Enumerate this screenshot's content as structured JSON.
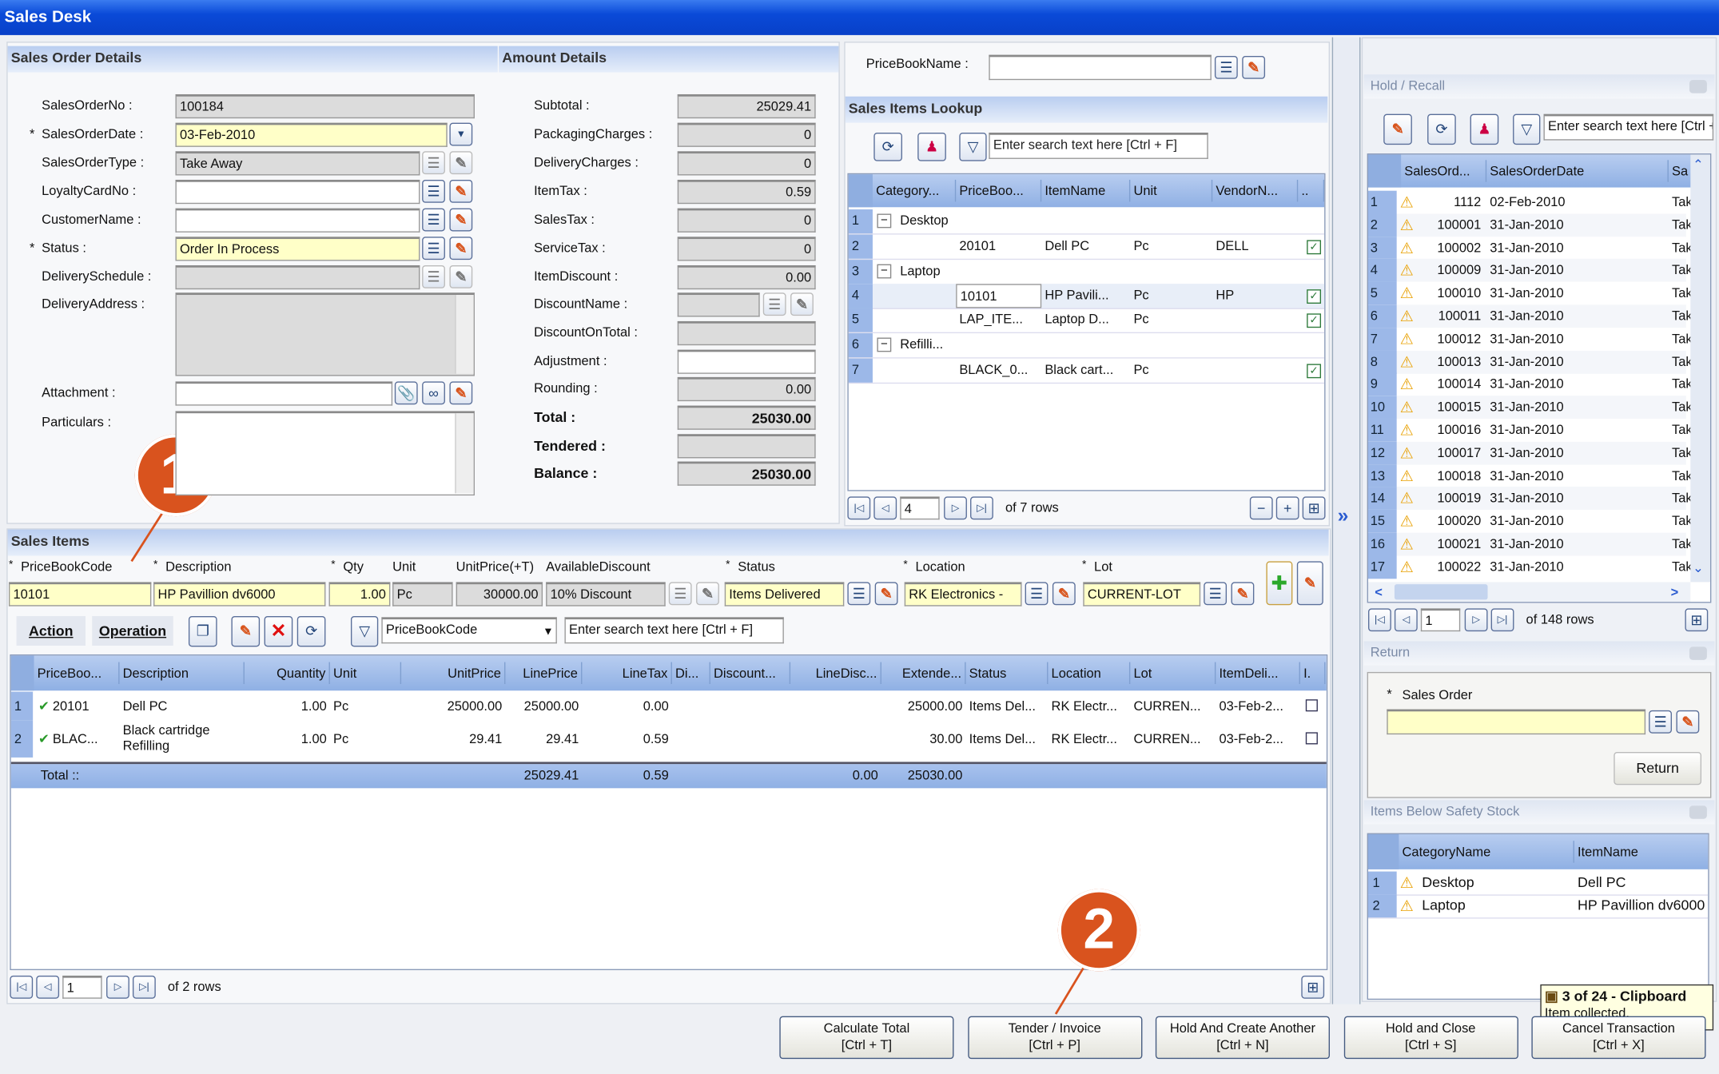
{
  "window": {
    "title": "Sales Desk"
  },
  "sales_order_details": {
    "title": "Sales Order Details",
    "fields": [
      {
        "label": "SalesOrderNo :",
        "value": "100184",
        "required": false,
        "state": "readonly",
        "icons": []
      },
      {
        "label": "SalesOrderDate :",
        "value": "03-Feb-2010",
        "required": true,
        "state": "required",
        "icons": [
          "dropdown"
        ]
      },
      {
        "label": "SalesOrderType :",
        "value": "Take Away",
        "required": false,
        "state": "readonly",
        "icons": [
          "list-gray",
          "eraser-gray"
        ]
      },
      {
        "label": "LoyaltyCardNo :",
        "value": "",
        "required": false,
        "state": "editable",
        "icons": [
          "list",
          "eraser"
        ]
      },
      {
        "label": "CustomerName :",
        "value": "",
        "required": false,
        "state": "editable",
        "icons": [
          "list",
          "eraser"
        ]
      },
      {
        "label": "Status :",
        "value": "Order In Process",
        "required": true,
        "state": "required",
        "icons": [
          "list",
          "eraser"
        ]
      },
      {
        "label": "DeliverySchedule :",
        "value": "",
        "required": false,
        "state": "readonly",
        "icons": [
          "list-gray",
          "eraser-gray"
        ]
      },
      {
        "label": "DeliveryAddress :",
        "value": "",
        "required": false,
        "state": "readonly",
        "icons": []
      },
      {
        "label": "Attachment :",
        "value": "",
        "required": false,
        "state": "editable",
        "icons": [
          "paperclip",
          "glasses",
          "eraser"
        ]
      },
      {
        "label": "Particulars :",
        "value": "",
        "required": false,
        "state": "editable",
        "icons": []
      }
    ]
  },
  "amount_details": {
    "title": "Amount Details",
    "fields": [
      {
        "label": "Subtotal :",
        "value": "25029.41",
        "state": "readonly",
        "bold": false
      },
      {
        "label": "PackagingCharges :",
        "value": "0",
        "state": "readonly",
        "bold": false
      },
      {
        "label": "DeliveryCharges :",
        "value": "0",
        "state": "readonly",
        "bold": false
      },
      {
        "label": "ItemTax :",
        "value": "0.59",
        "state": "readonly",
        "bold": false
      },
      {
        "label": "SalesTax :",
        "value": "0",
        "state": "readonly",
        "bold": false
      },
      {
        "label": "ServiceTax :",
        "value": "0",
        "state": "readonly",
        "bold": false
      },
      {
        "label": "ItemDiscount :",
        "value": "0.00",
        "state": "readonly",
        "bold": false
      },
      {
        "label": "DiscountName :",
        "value": "",
        "state": "readonly",
        "bold": false
      },
      {
        "label": "DiscountOnTotal :",
        "value": "",
        "state": "readonly",
        "bold": false
      },
      {
        "label": "Adjustment :",
        "value": "",
        "state": "editable",
        "bold": false
      },
      {
        "label": "Rounding :",
        "value": "0.00",
        "state": "readonly",
        "bold": false
      },
      {
        "label": "Total :",
        "value": "25030.00",
        "state": "readonly",
        "bold": true
      },
      {
        "label": "Tendered :",
        "value": "",
        "state": "readonly",
        "bold": true
      },
      {
        "label": "Balance :",
        "value": "25030.00",
        "state": "readonly",
        "bold": true
      }
    ]
  },
  "lookup": {
    "pricebook_label": "PriceBookName :",
    "pricebook_value": "",
    "title": "Sales Items Lookup",
    "search_placeholder": "Enter search text here [Ctrl + F]",
    "columns": [
      "Category...",
      "PriceBoo...",
      "ItemName",
      "Unit",
      "VendorN...",
      ".."
    ],
    "rows": [
      {
        "group": "Desktop"
      },
      {
        "cells": [
          "",
          "20101",
          "Dell PC",
          "Pc",
          "DELL"
        ],
        "checked": true
      },
      {
        "group": "Laptop"
      },
      {
        "cells": [
          "",
          "10101",
          "HP Pavili...",
          "Pc",
          "HP"
        ],
        "checked": true,
        "selected": true
      },
      {
        "cells": [
          "",
          "LAP_ITE...",
          "Laptop D...",
          "Pc",
          ""
        ],
        "checked": true
      },
      {
        "group": "Refilli..."
      },
      {
        "cells": [
          "",
          "BLACK_0...",
          "Black cart...",
          "Pc",
          ""
        ],
        "checked": true
      }
    ],
    "pager": {
      "current": "4",
      "total": "of 7 rows"
    }
  },
  "sales_items": {
    "title": "Sales Items",
    "entry": {
      "labels": [
        "PriceBookCode",
        "Description",
        "Qty",
        "Unit",
        "UnitPrice(+T)",
        "AvailableDiscount",
        "Status",
        "Location",
        "Lot"
      ],
      "values": {
        "pricebook_code": "10101",
        "description": "HP Pavillion dv6000",
        "qty": "1.00",
        "unit": "Pc",
        "unit_price": "30000.00",
        "available_discount": "10% Discount",
        "status": "Items Delivered",
        "location": "RK Electronics -",
        "lot": "CURRENT-LOT"
      }
    },
    "tabs": [
      "Action",
      "Operation"
    ],
    "filter_column": "PriceBookCode",
    "search_placeholder": "Enter search text here [Ctrl + F]",
    "columns": [
      "PriceBoo...",
      "Description",
      "Quantity",
      "Unit",
      "UnitPrice",
      "LinePrice",
      "LineTax",
      "Di...",
      "Discount...",
      "LineDisc...",
      "Extende...",
      "Status",
      "Location",
      "Lot",
      "ItemDeli...",
      "I."
    ],
    "rows": [
      [
        "20101",
        "Dell PC",
        "1.00",
        "Pc",
        "25000.00",
        "25000.00",
        "0.00",
        "",
        "",
        "",
        "25000.00",
        "Items Del...",
        "RK Electr...",
        "CURREN...",
        "03-Feb-2..."
      ],
      [
        "BLAC...",
        "Black cartridge Refilling",
        "1.00",
        "Pc",
        "29.41",
        "29.41",
        "0.59",
        "",
        "",
        "",
        "30.00",
        "Items Del...",
        "RK Electr...",
        "CURREN...",
        "03-Feb-2..."
      ]
    ],
    "total": {
      "label": "Total ::",
      "line_price": "25029.41",
      "line_tax": "0.59",
      "line_disc": "0.00",
      "extended": "25030.00"
    },
    "pager": {
      "current": "1",
      "total": "of 2 rows"
    }
  },
  "hold_recall": {
    "title": "Hold / Recall",
    "search_placeholder": "Enter search text here [Ctrl + F]",
    "columns": [
      "SalesOrd...",
      "SalesOrderDate",
      "Sa"
    ],
    "rows": [
      [
        "1112",
        "02-Feb-2010",
        "Take Away"
      ],
      [
        "100001",
        "31-Jan-2010",
        "Take Away"
      ],
      [
        "100002",
        "31-Jan-2010",
        "Take Away"
      ],
      [
        "100009",
        "31-Jan-2010",
        "Take Away"
      ],
      [
        "100010",
        "31-Jan-2010",
        "Take Away"
      ],
      [
        "100011",
        "31-Jan-2010",
        "Take Away"
      ],
      [
        "100012",
        "31-Jan-2010",
        "Take Away"
      ],
      [
        "100013",
        "31-Jan-2010",
        "Take Away"
      ],
      [
        "100014",
        "31-Jan-2010",
        "Take Away"
      ],
      [
        "100015",
        "31-Jan-2010",
        "Take Away"
      ],
      [
        "100016",
        "31-Jan-2010",
        "Take Away"
      ],
      [
        "100017",
        "31-Jan-2010",
        "Take Away"
      ],
      [
        "100018",
        "31-Jan-2010",
        "Take Away"
      ],
      [
        "100019",
        "31-Jan-2010",
        "Take Away"
      ],
      [
        "100020",
        "31-Jan-2010",
        "Take Away"
      ],
      [
        "100021",
        "31-Jan-2010",
        "Take Away"
      ],
      [
        "100022",
        "31-Jan-2010",
        "Take Away"
      ]
    ],
    "pager": {
      "current": "1",
      "total": "of 148 rows"
    }
  },
  "return_panel": {
    "title": "Return",
    "field_label": "Sales Order",
    "field_value": "",
    "button": "Return"
  },
  "safety_stock": {
    "title": "Items Below Safety Stock",
    "columns": [
      "CategoryName",
      "ItemName"
    ],
    "rows": [
      [
        "Desktop",
        "Dell PC"
      ],
      [
        "Laptop",
        "HP Pavillion dv6000"
      ]
    ]
  },
  "actions": [
    {
      "label": "Calculate Total",
      "shortcut": "[Ctrl + T]"
    },
    {
      "label": "Tender / Invoice",
      "shortcut": "[Ctrl + P]"
    },
    {
      "label": "Hold And Create Another",
      "shortcut": "[Ctrl + N]"
    },
    {
      "label": "Hold and Close",
      "shortcut": "[Ctrl + S]"
    },
    {
      "label": "Cancel Transaction",
      "shortcut": "[Ctrl + X]"
    }
  ],
  "tooltip": {
    "title": "3 of 24 - Clipboard",
    "message": "Item collected."
  },
  "annotations": [
    "1",
    "2"
  ],
  "colors": {
    "title_bar": "#0a4ad8",
    "required_field": "#ffffc8",
    "readonly_field": "#dcdcdc",
    "grid_header": "#9fbbe8",
    "annotation": "#d9531e"
  }
}
